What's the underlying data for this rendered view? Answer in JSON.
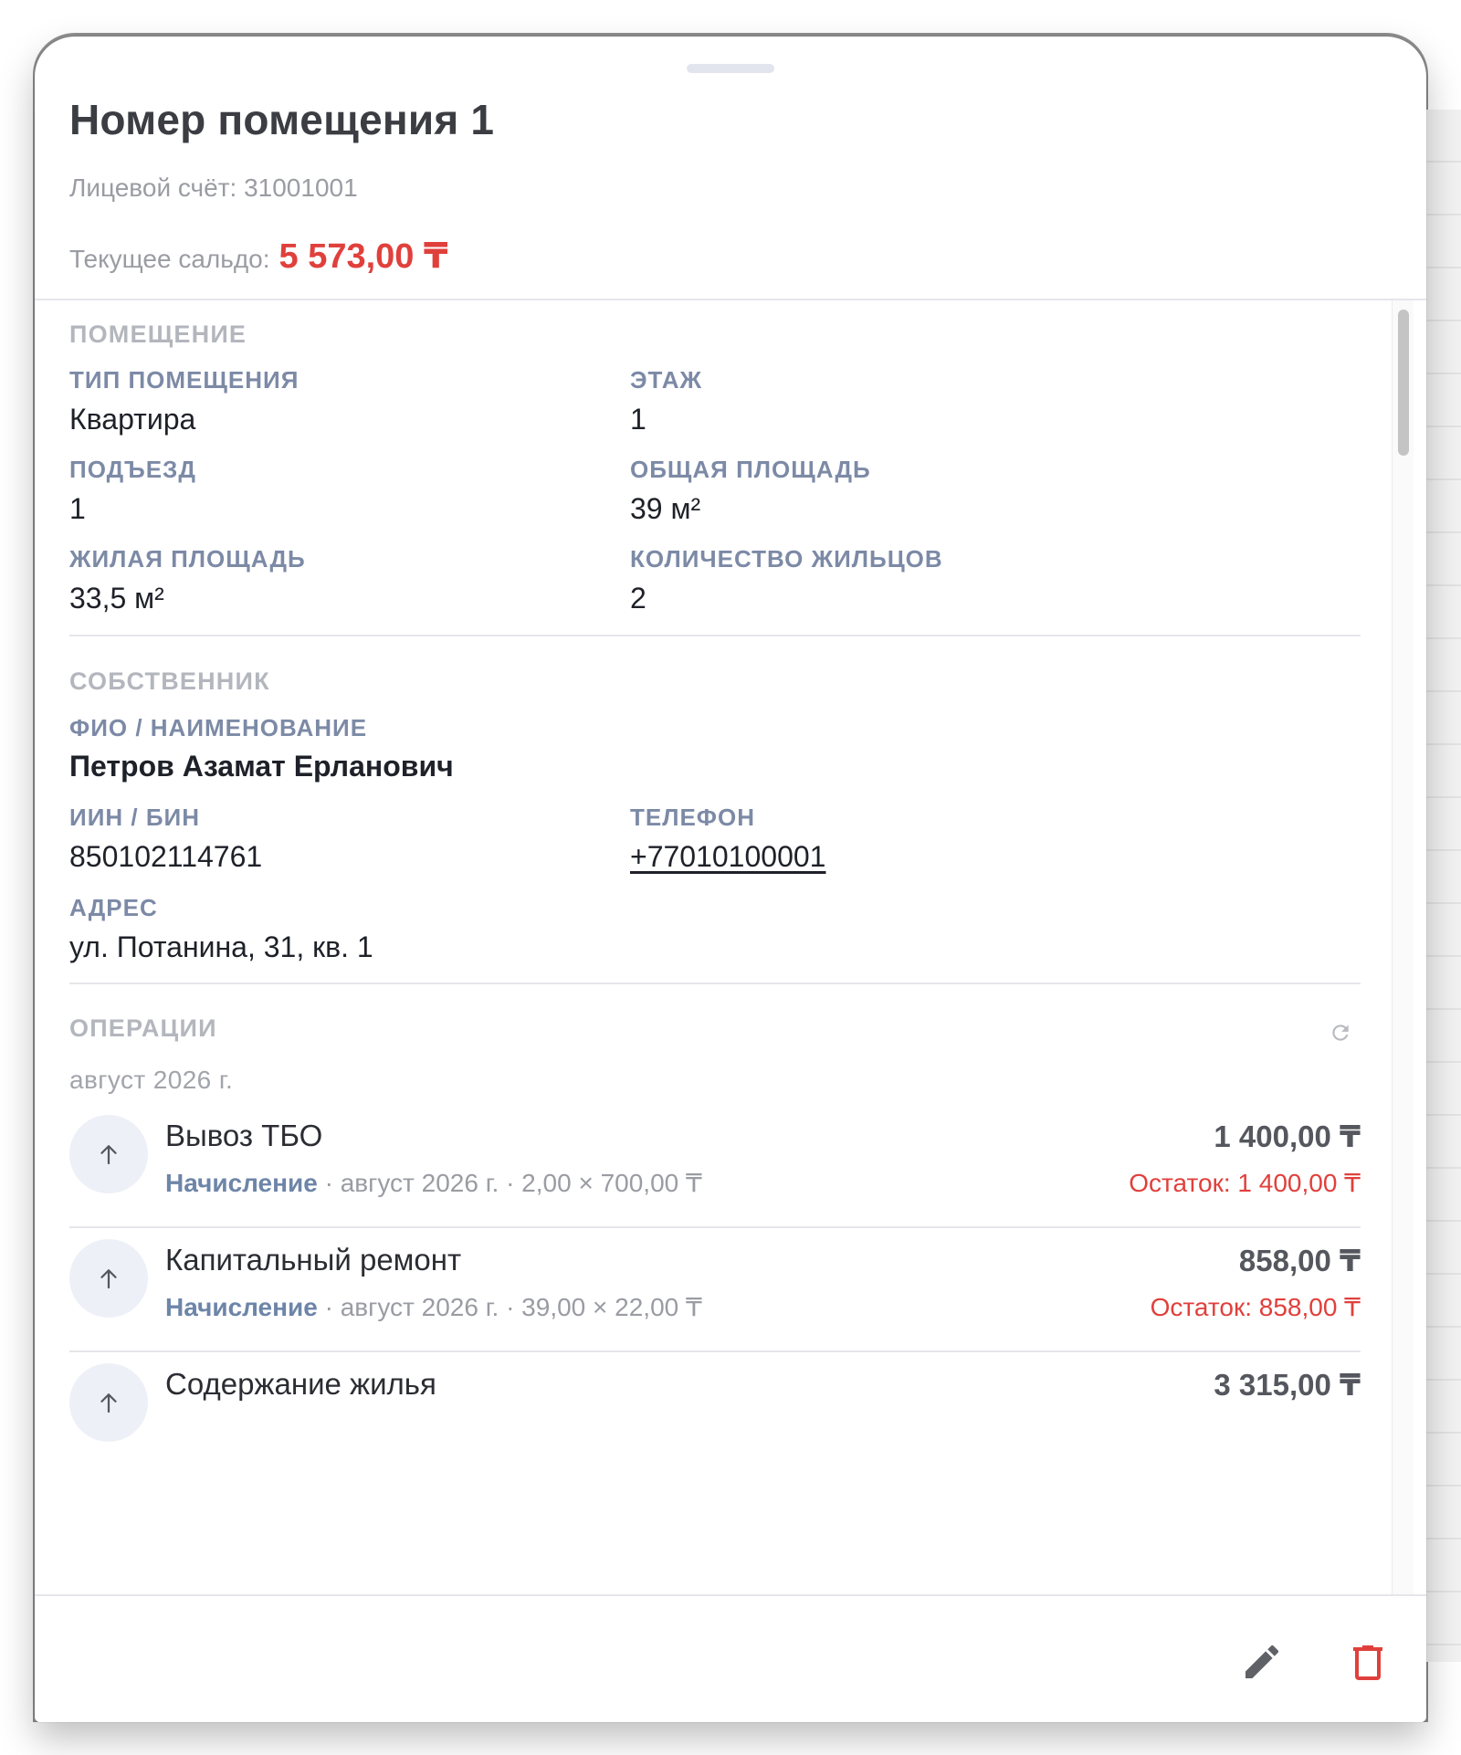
{
  "header": {
    "title": "Номер помещения 1",
    "account": "Лицевой счёт: 31001001",
    "balance_label": "Текущее сальдо:",
    "balance_value": "5 573,00 ₸"
  },
  "premises": {
    "section_title": "ПОМЕЩЕНИЕ",
    "type_label": "ТИП ПОМЕЩЕНИЯ",
    "type_value": "Квартира",
    "floor_label": "ЭТАЖ",
    "floor_value": "1",
    "entrance_label": "ПОДЪЕЗД",
    "entrance_value": "1",
    "total_area_label": "ОБЩАЯ ПЛОЩАДЬ",
    "total_area_value": "39 м²",
    "living_area_label": "ЖИЛАЯ ПЛОЩАДЬ",
    "living_area_value": "33,5 м²",
    "residents_label": "КОЛИЧЕСТВО ЖИЛЬЦОВ",
    "residents_value": "2"
  },
  "owner": {
    "section_title": "СОБСТВЕННИК",
    "name_label": "ФИО / НАИМЕНОВАНИЕ",
    "name_value": "Петров Азамат Ерланович",
    "iin_label": "ИИН / БИН",
    "iin_value": "850102114761",
    "phone_label": "ТЕЛЕФОН",
    "phone_value": "+77010100001",
    "address_label": "АДРЕС",
    "address_value": "ул. Потанина, 31, кв. 1"
  },
  "operations": {
    "section_title": "ОПЕРАЦИИ",
    "refresh_icon": "refresh-icon",
    "month": "август 2026 г.",
    "items": [
      {
        "title": "Вывоз ТБО",
        "type": "Начисление",
        "meta": " · август 2026 г. · 2,00 × 700,00 ₸",
        "amount": "1 400,00 ₸",
        "rest": "Остаток: 1 400,00 ₸"
      },
      {
        "title": "Капитальный ремонт",
        "type": "Начисление",
        "meta": " · август 2026 г. · 39,00 × 22,00 ₸",
        "amount": "858,00 ₸",
        "rest": "Остаток: 858,00 ₸"
      },
      {
        "title": "Содержание жилья",
        "type": "",
        "meta": "",
        "amount": "3 315,00 ₸",
        "rest": ""
      }
    ]
  },
  "footer": {
    "edit_icon": "pencil-icon",
    "delete_icon": "trash-icon"
  },
  "colors": {
    "accent_red": "#e0403c",
    "label_blue": "#7c8aa6",
    "type_blue": "#6d85a8"
  }
}
